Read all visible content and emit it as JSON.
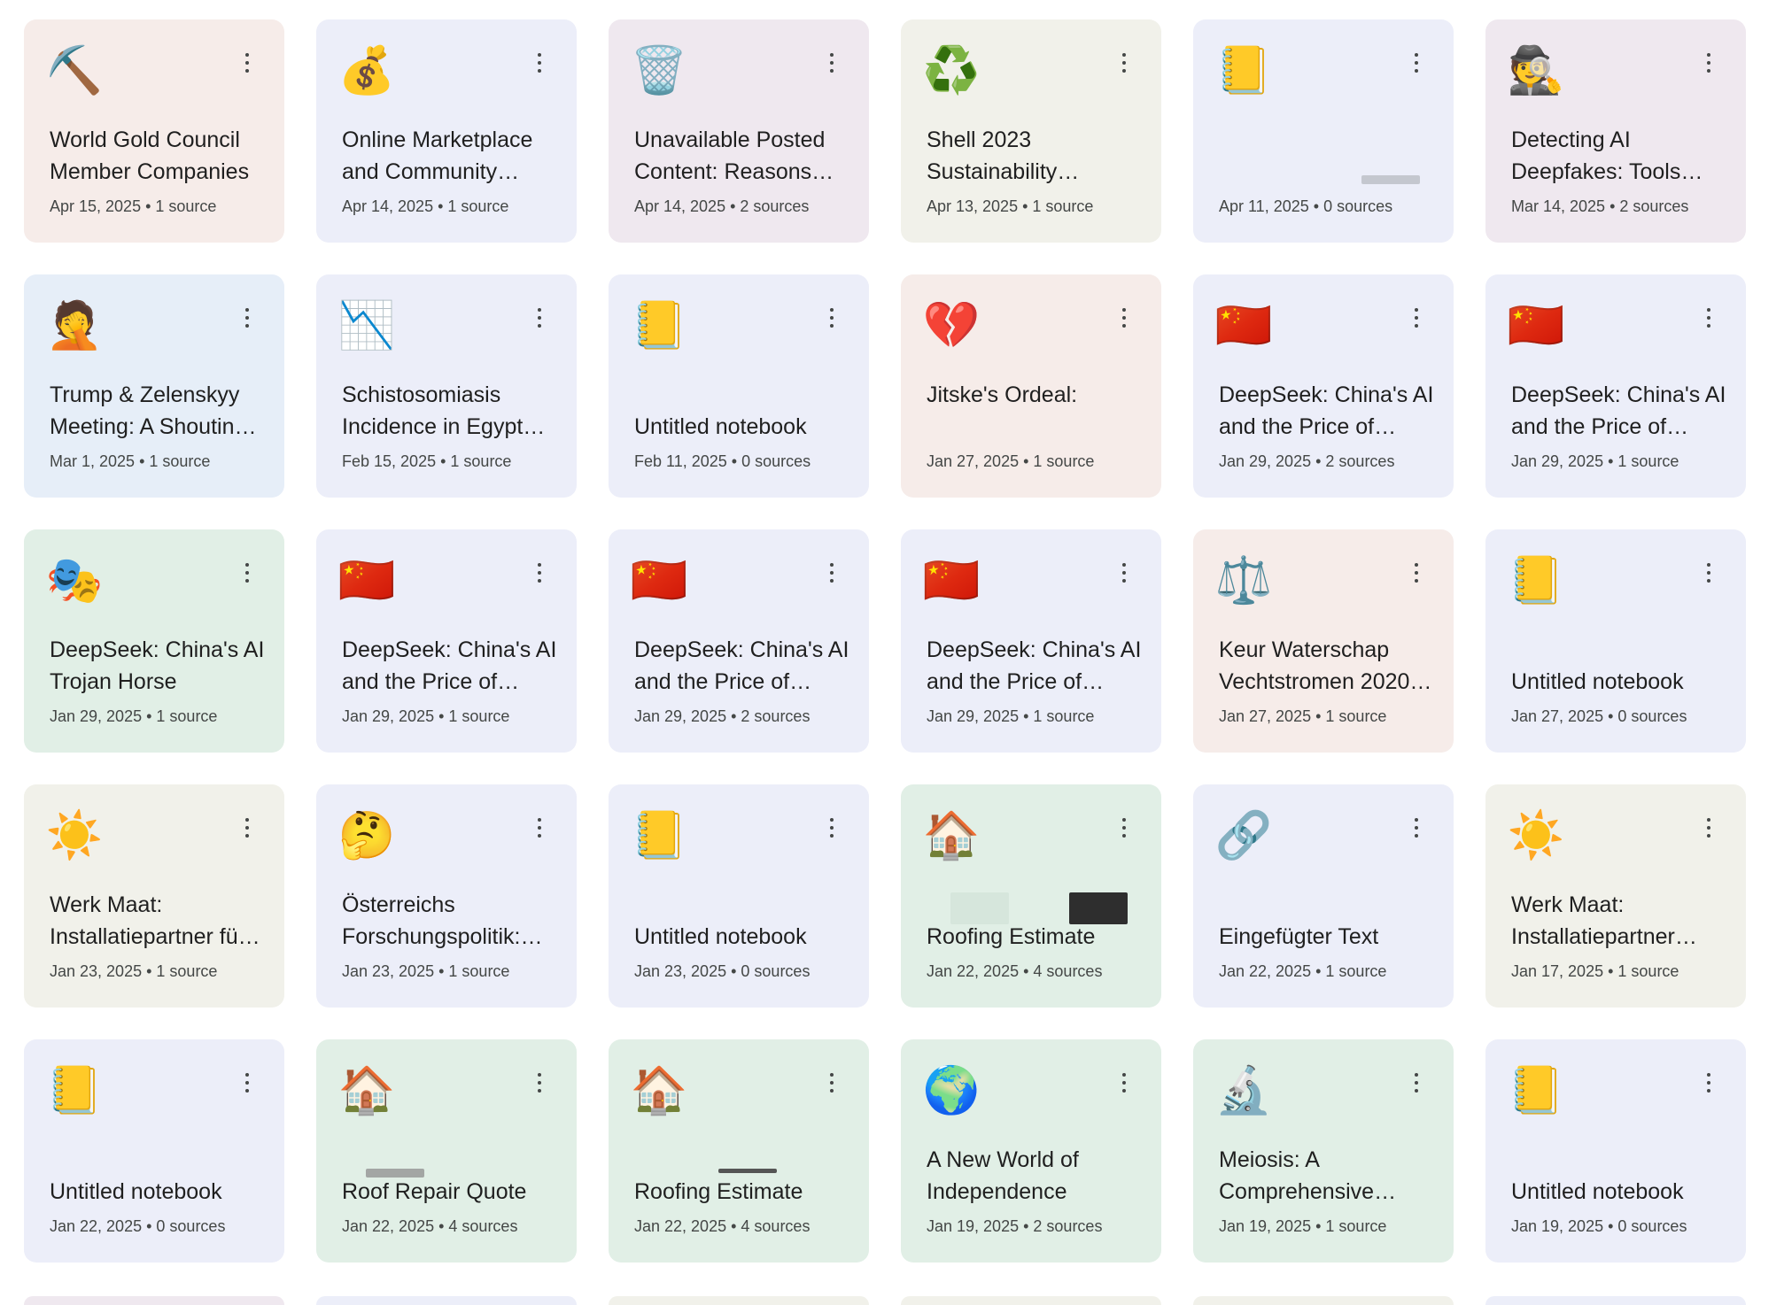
{
  "cards": [
    {
      "emoji": "⛏️",
      "emoji_name": "pick-icon",
      "title": "World Gold Council Member Companies",
      "date": "Apr 15, 2025",
      "sources": "1 source",
      "color": "pink"
    },
    {
      "emoji": "💰",
      "emoji_name": "money-bag-icon",
      "title": "Online Marketplace and Community…",
      "date": "Apr 14, 2025",
      "sources": "1 source",
      "color": "lav"
    },
    {
      "emoji": "🗑️",
      "emoji_name": "wastebasket-icon",
      "title": "Unavailable Posted Content: Reasons…",
      "date": "Apr 14, 2025",
      "sources": "2 sources",
      "color": "mauve"
    },
    {
      "emoji": "♻️",
      "emoji_name": "recycle-icon",
      "title": "Shell 2023 Sustainability…",
      "date": "Apr 13, 2025",
      "sources": "1 source",
      "color": "beige"
    },
    {
      "emoji": "📒",
      "emoji_name": "notebook-icon",
      "title": "",
      "date": "Apr 11, 2025",
      "sources": "0 sources",
      "color": "lav"
    },
    {
      "emoji": "🕵️",
      "emoji_name": "detective-icon",
      "title": "Detecting AI Deepfakes: Tools an…",
      "date": "Mar 14, 2025",
      "sources": "2 sources",
      "color": "mauve"
    },
    {
      "emoji": "🤦",
      "emoji_name": "facepalm-icon",
      "title": "Trump & Zelenskyy Meeting: A Shoutin…",
      "date": "Mar 1, 2025",
      "sources": "1 source",
      "color": "blue"
    },
    {
      "emoji": "📉",
      "emoji_name": "chart-decreasing-icon",
      "title": "Schistosomiasis Incidence in Egypt…",
      "date": "Feb 15, 2025",
      "sources": "1 source",
      "color": "lav"
    },
    {
      "emoji": "📒",
      "emoji_name": "notebook-icon",
      "title": "Untitled notebook",
      "date": "Feb 11, 2025",
      "sources": "0 sources",
      "color": "lav",
      "single": true
    },
    {
      "emoji": "💔",
      "emoji_name": "broken-heart-icon",
      "title": "Jitske's Ordeal:",
      "date": "Jan 27, 2025",
      "sources": "1 source",
      "color": "pink"
    },
    {
      "emoji": "🇨🇳",
      "emoji_name": "china-flag-icon",
      "title": "DeepSeek: China's AI and the Price of…",
      "date": "Jan 29, 2025",
      "sources": "2 sources",
      "color": "lav"
    },
    {
      "emoji": "🇨🇳",
      "emoji_name": "china-flag-icon",
      "title": "DeepSeek: China's AI and the Price of…",
      "date": "Jan 29, 2025",
      "sources": "1 source",
      "color": "lav"
    },
    {
      "emoji": "🎭",
      "emoji_name": "performing-arts-icon",
      "title": "DeepSeek: China's AI Trojan Horse",
      "date": "Jan 29, 2025",
      "sources": "1 source",
      "color": "green"
    },
    {
      "emoji": "🇨🇳",
      "emoji_name": "china-flag-icon",
      "title": "DeepSeek: China's AI and the Price of…",
      "date": "Jan 29, 2025",
      "sources": "1 source",
      "color": "lav"
    },
    {
      "emoji": "🇨🇳",
      "emoji_name": "china-flag-icon",
      "title": "DeepSeek: China's AI and the Price of…",
      "date": "Jan 29, 2025",
      "sources": "2 sources",
      "color": "lav"
    },
    {
      "emoji": "🇨🇳",
      "emoji_name": "china-flag-icon",
      "title": "DeepSeek: China's AI and the Price of…",
      "date": "Jan 29, 2025",
      "sources": "1 source",
      "color": "lav"
    },
    {
      "emoji": "⚖️",
      "emoji_name": "balance-scale-icon",
      "title": "Keur Waterschap Vechtstromen 2020…",
      "date": "Jan 27, 2025",
      "sources": "1 source",
      "color": "pink"
    },
    {
      "emoji": "📒",
      "emoji_name": "notebook-icon",
      "title": "Untitled notebook",
      "date": "Jan 27, 2025",
      "sources": "0 sources",
      "color": "lav",
      "single": true
    },
    {
      "emoji": "☀️",
      "emoji_name": "sun-icon",
      "title": "Werk Maat: Installatiepartner fü…",
      "date": "Jan 23, 2025",
      "sources": "1 source",
      "color": "beige"
    },
    {
      "emoji": "🤔",
      "emoji_name": "thinking-face-icon",
      "title": "Österreichs Forschungspolitik:…",
      "date": "Jan 23, 2025",
      "sources": "1 source",
      "color": "lav"
    },
    {
      "emoji": "📒",
      "emoji_name": "notebook-icon",
      "title": "Untitled notebook",
      "date": "Jan 23, 2025",
      "sources": "0 sources",
      "color": "lav",
      "single": true
    },
    {
      "emoji": "🏠",
      "emoji_name": "house-icon",
      "title": "Roofing Estimate",
      "date": "Jan 22, 2025",
      "sources": "4 sources",
      "color": "green",
      "single": true
    },
    {
      "emoji": "🔗",
      "emoji_name": "link-icon",
      "title": "Eingefügter Text",
      "date": "Jan 22, 2025",
      "sources": "1 source",
      "color": "lav",
      "single": true
    },
    {
      "emoji": "☀️",
      "emoji_name": "sun-icon",
      "title": "Werk Maat: Installatiepartner…",
      "date": "Jan 17, 2025",
      "sources": "1 source",
      "color": "beige"
    },
    {
      "emoji": "📒",
      "emoji_name": "notebook-icon",
      "title": "Untitled notebook",
      "date": "Jan 22, 2025",
      "sources": "0 sources",
      "color": "lav",
      "single": true
    },
    {
      "emoji": "🏠",
      "emoji_name": "house-icon",
      "title": "Roof Repair Quote",
      "date": "Jan 22, 2025",
      "sources": "4 sources",
      "color": "green",
      "single": true
    },
    {
      "emoji": "🏠",
      "emoji_name": "house-icon",
      "title": "Roofing Estimate",
      "date": "Jan 22, 2025",
      "sources": "4 sources",
      "color": "green",
      "single": true
    },
    {
      "emoji": "🌍",
      "emoji_name": "globe-icon",
      "title": "A New World of Independence",
      "date": "Jan 19, 2025",
      "sources": "2 sources",
      "color": "green"
    },
    {
      "emoji": "🔬",
      "emoji_name": "microscope-icon",
      "title": "Meiosis: A Comprehensive…",
      "date": "Jan 19, 2025",
      "sources": "1 source",
      "color": "green"
    },
    {
      "emoji": "📒",
      "emoji_name": "notebook-icon",
      "title": "Untitled notebook",
      "date": "Jan 19, 2025",
      "sources": "0 sources",
      "color": "lav",
      "single": true
    }
  ],
  "partial_row_colors": [
    "mauve",
    "lav",
    "beige",
    "beige",
    "beige",
    "lav"
  ],
  "colors": {
    "pink": "#f6ece9",
    "lav": "#eceef9",
    "mauve": "#efe8ef",
    "beige": "#f1f1ea",
    "blue": "#e6eef8",
    "green": "#e1efe6",
    "text": "#1f1f1f",
    "meta": "#444746"
  },
  "separator": " • "
}
